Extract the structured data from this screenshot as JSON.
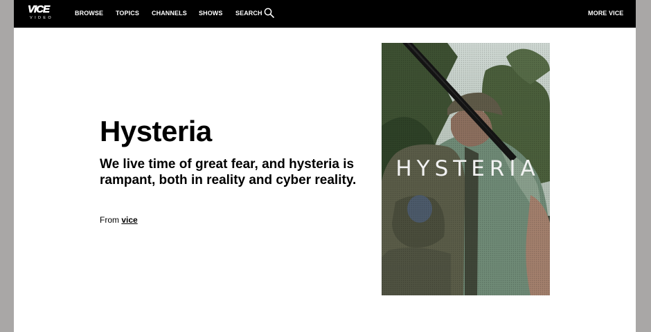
{
  "header": {
    "logo_text": "VICE",
    "logo_subtext": "VIDEO",
    "nav": {
      "browse": "BROWSE",
      "topics": "TOPICS",
      "channels": "CHANNELS",
      "shows": "SHOWS",
      "search": "SEARCH",
      "more": "MORE VICE"
    },
    "icons": {
      "search": "search-icon"
    }
  },
  "main": {
    "title": "Hysteria",
    "description": "We live time of great fear, and hysteria is rampant, both in reality and cyber reality.",
    "source_prefix": "From",
    "source_link": "vice",
    "poster_title": "HYSTERIA"
  },
  "colors": {
    "navbar_background": "#000000",
    "page_background": "#ffffff",
    "outer_background": "#a9a7a6",
    "text": "#000000"
  }
}
